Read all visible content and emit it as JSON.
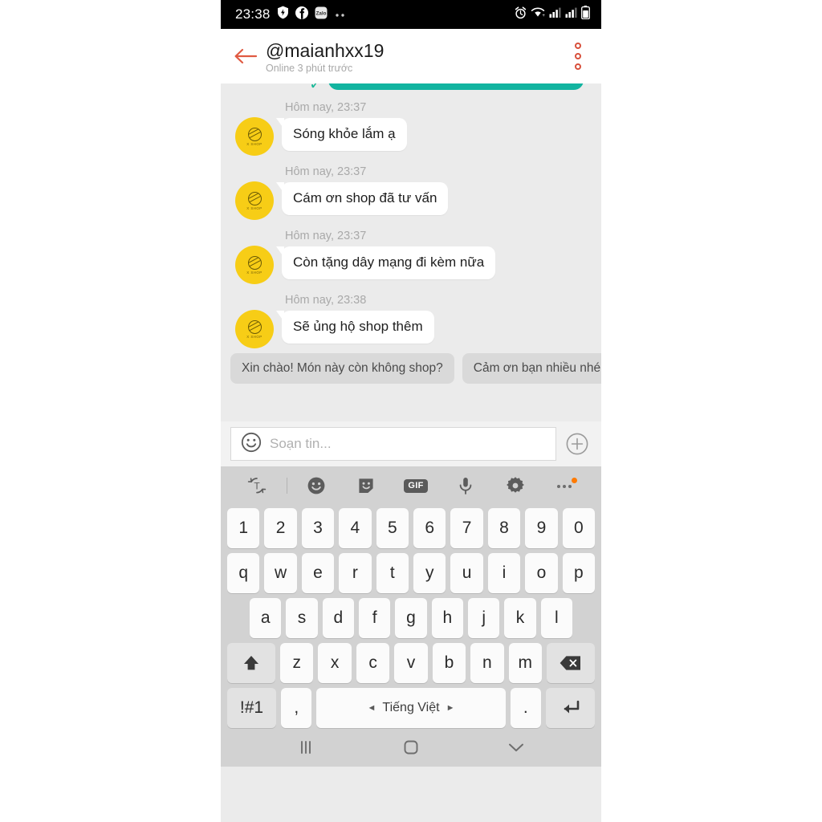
{
  "status_bar": {
    "time": "23:38",
    "left_icons": [
      "shield-icon",
      "facebook-icon",
      "zalo-icon",
      "more-dots-icon"
    ],
    "right_icons": [
      "alarm-icon",
      "wifi-icon",
      "signal-icon",
      "signal-icon-2",
      "battery-icon"
    ]
  },
  "header": {
    "back_icon": "back-arrow-icon",
    "title": "@maianhxx19",
    "subtitle": "Online 3 phút trước",
    "menu_icon": "kebab-menu-icon"
  },
  "conversation": {
    "outgoing_partial": {
      "tick": "✓",
      "text": ""
    },
    "messages": [
      {
        "time": "Hôm nay, 23:37",
        "text": "Sóng khỏe lắm ạ",
        "avatar_label": "X SHOP"
      },
      {
        "time": "Hôm nay, 23:37",
        "text": "Cám ơn shop đã tư vấn",
        "avatar_label": "X SHOP"
      },
      {
        "time": "Hôm nay, 23:37",
        "text": "Còn tặng dây mạng đi kèm nữa",
        "avatar_label": "X SHOP"
      },
      {
        "time": "Hôm nay, 23:38",
        "text": "Sẽ ủng hộ shop thêm",
        "avatar_label": "X SHOP"
      }
    ]
  },
  "quick_replies": [
    "Xin chào! Món này còn không shop?",
    "Cảm ơn bạn nhiều nhé!"
  ],
  "input_bar": {
    "emoji_icon": "smiley-icon",
    "placeholder": "Soạn tin...",
    "value": "",
    "add_icon": "plus-circle-icon"
  },
  "keyboard": {
    "toolbar": [
      "translate-icon",
      "emoji-icon",
      "sticker-icon",
      "gif-icon",
      "microphone-icon",
      "settings-gear-icon",
      "more-options-icon"
    ],
    "gif_label": "GIF",
    "rows": {
      "numbers": [
        "1",
        "2",
        "3",
        "4",
        "5",
        "6",
        "7",
        "8",
        "9",
        "0"
      ],
      "top": [
        "q",
        "w",
        "e",
        "r",
        "t",
        "y",
        "u",
        "i",
        "o",
        "p"
      ],
      "home": [
        "a",
        "s",
        "d",
        "f",
        "g",
        "h",
        "j",
        "k",
        "l"
      ],
      "bottom": [
        "z",
        "x",
        "c",
        "v",
        "b",
        "n",
        "m"
      ],
      "shift_icon": "shift-arrow-icon",
      "backspace_icon": "backspace-icon"
    },
    "bottom_row": {
      "symbols": "!#1",
      "comma": ",",
      "space_label": "Tiếng Việt",
      "space_left_arrow": "◄",
      "space_right_arrow": "►",
      "period": ".",
      "enter_icon": "enter-return-icon"
    }
  },
  "nav_bar": {
    "recents_icon": "recents-icon",
    "home_icon": "home-icon",
    "hide-keyboard_icon": "chevron-down-icon"
  },
  "colors": {
    "outgoing_bubble": "#12b4a0",
    "avatar": "#f7cd16",
    "accent_red": "#d8503c",
    "badge_orange": "#ff7a00",
    "chat_bg": "#ebebeb",
    "keyboard_bg": "#d2d2d2"
  }
}
